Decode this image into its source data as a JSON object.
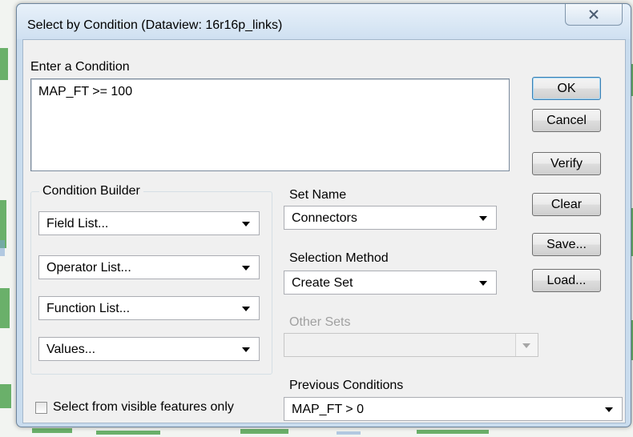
{
  "window": {
    "title": "Select by Condition (Dataview: 16r16p_links)",
    "close_icon": "close-icon"
  },
  "condition": {
    "label": "Enter a Condition",
    "value": "MAP_FT >= 100"
  },
  "buttons": {
    "ok": "OK",
    "cancel": "Cancel",
    "verify": "Verify",
    "clear": "Clear",
    "save": "Save...",
    "load": "Load..."
  },
  "builder": {
    "label": "Condition Builder",
    "field_list": "Field List...",
    "operator_list": "Operator List...",
    "function_list": "Function List...",
    "values": "Values..."
  },
  "set_name": {
    "label": "Set Name",
    "value": "Connectors"
  },
  "selection_method": {
    "label": "Selection Method",
    "value": "Create Set"
  },
  "other_sets": {
    "label": "Other Sets",
    "value": ""
  },
  "previous_conditions": {
    "label": "Previous Conditions",
    "value": "MAP_FT > 0"
  },
  "visible_only": {
    "label": "Select from visible features only",
    "checked": false
  },
  "colors": {
    "title_bar": "#cfe0f1",
    "dialog_bg": "#f0f0f0",
    "default_button_border": "#3c7fb1"
  }
}
